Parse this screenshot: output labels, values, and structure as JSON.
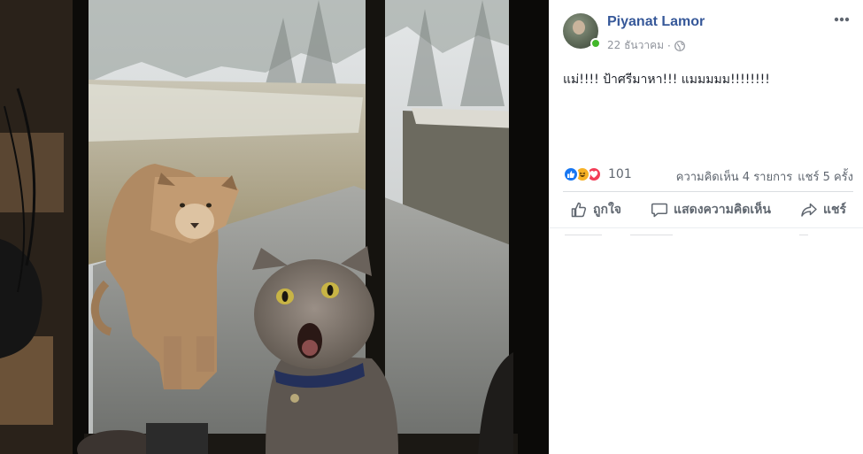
{
  "post": {
    "author": "Piyanat Lamor",
    "date": "22 ธันวาคม",
    "separator": "·",
    "privacy_icon": "globe-icon",
    "message": "แม่!!!! ป้าศรีมาหา!!! แมมมมม!!!!!!!!"
  },
  "stats": {
    "reaction_icons": [
      "like-reaction-icon",
      "haha-reaction-icon",
      "love-reaction-icon"
    ],
    "reaction_count": "101",
    "comments": "ความคิดเห็น 4 รายการ",
    "shares": "แชร์ 5 ครั้ง"
  },
  "actions": {
    "like": "ถูกใจ",
    "comment": "แสดงความคิดเห็น",
    "share": "แชร์"
  },
  "colors": {
    "author_link": "#365899",
    "online": "#42b72a",
    "like_blue": "#1877f2",
    "haha_yellow": "#f7b125",
    "love_red": "#f33e58"
  }
}
